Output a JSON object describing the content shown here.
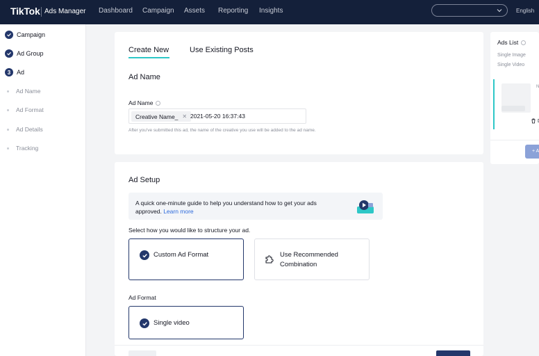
{
  "topbar": {
    "logo": "TikTok",
    "logo_sub": "Ads Manager",
    "nav": [
      "Dashboard",
      "Campaign",
      "Assets",
      "Reporting",
      "Insights"
    ],
    "account_value": "",
    "language": "English"
  },
  "sidebar": {
    "steps": [
      {
        "label": "Campaign",
        "state": "done"
      },
      {
        "label": "Ad Group",
        "state": "done"
      },
      {
        "label": "Ad",
        "state": "current",
        "number": "3"
      }
    ],
    "substeps": [
      "Ad Name",
      "Ad Format",
      "Ad Details",
      "Tracking"
    ]
  },
  "ad_name_card": {
    "tabs": [
      "Create New",
      "Use Existing Posts"
    ],
    "active_tab": "Create New",
    "section_title": "Ad Name",
    "field_label": "Ad Name",
    "chip": "Creative Name_",
    "timestamp": "2021-05-20 16:37:43",
    "hint": "After you've submitted this ad, the name of the creative you use will be added to the ad name."
  },
  "ad_setup_card": {
    "section_title": "Ad Setup",
    "guide_text": "A quick one-minute guide to help you understand how to get your ads approved.",
    "guide_link": "Learn more",
    "select_label": "Select how you would like to structure your ad.",
    "structure_options": [
      {
        "label": "Custom Ad Format",
        "selected": true
      },
      {
        "label": "Use Recommended Combination",
        "selected": false
      }
    ],
    "ad_format_label": "Ad Format",
    "ad_format_option": {
      "label": "Single video",
      "selected": true
    }
  },
  "ads_list": {
    "title": "Ads List",
    "items": [
      "Single Image",
      "Single Video"
    ],
    "thumb_text": "N",
    "trash_text": "D",
    "button_text": "+ A"
  },
  "colors": {
    "topbar_bg": "#14203a",
    "primary": "#23376b",
    "accent": "#2dc7c7",
    "link": "#2e6bdc"
  }
}
